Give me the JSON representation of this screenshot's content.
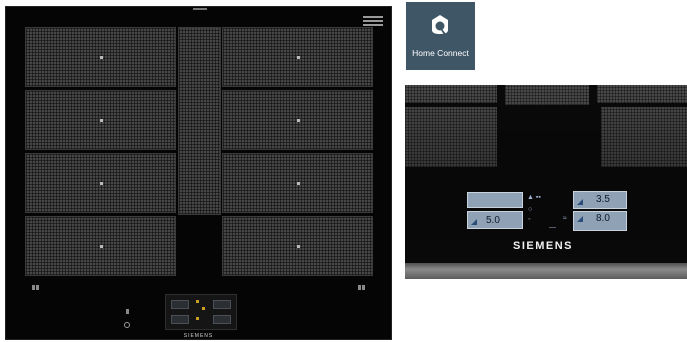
{
  "cooktop": {
    "brand": "SIEMENS"
  },
  "app_tile": {
    "label": "Home Connect",
    "icon": "home-connect-icon",
    "background": "#3f5667"
  },
  "closeup": {
    "brand": "SIEMENS",
    "displays": [
      {
        "value": "5.0"
      },
      {
        "value": "3.5"
      },
      {
        "value": "8.0"
      }
    ]
  }
}
